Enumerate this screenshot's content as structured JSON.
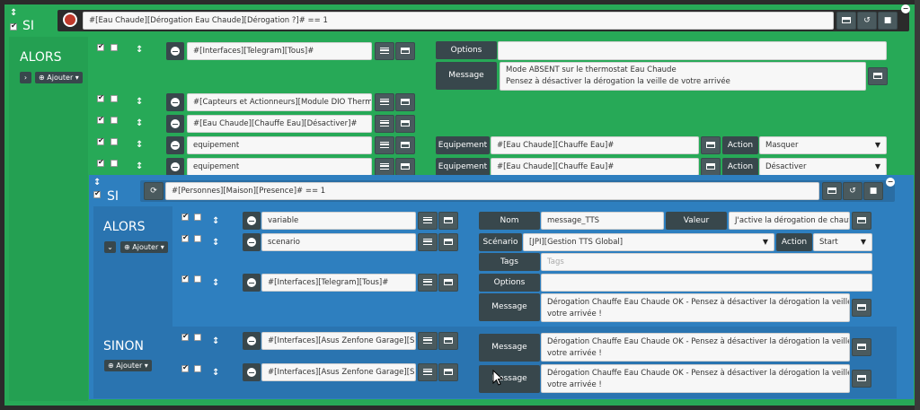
{
  "outer": {
    "si_label": "SI",
    "condition": "#[Eau Chaude][Dérogation Eau Chaude][Dérogation ?]# == 1",
    "alors_label": "ALORS",
    "add_label": "Ajouter",
    "rows": [
      {
        "cmd": "#[Interfaces][Telegram][Tous]#"
      },
      {
        "cmd": "#[Capteurs et Actionneurs][Module DIO Therm"
      },
      {
        "cmd": "#[Eau Chaude][Chauffe Eau][Désactiver]#"
      },
      {
        "cmd": "equipement"
      },
      {
        "cmd": "equipement"
      }
    ],
    "options_label": "Options",
    "message_label": "Message",
    "message_line1": "Mode ABSENT sur le thermostat Eau Chaude",
    "message_line2": "Pensez à désactiver la dérogation la veille de votre arrivée",
    "equipement_label": "Equipement",
    "equipement_value": "#[Eau Chaude][Chauffe Eau]#",
    "action_label": "Action",
    "action1": "Masquer",
    "action2": "Désactiver"
  },
  "inner": {
    "si_label": "SI",
    "condition": "#[Personnes][Maison][Presence]# == 1",
    "alors_label": "ALORS",
    "sinon_label": "SINON",
    "add_label": "Ajouter",
    "rows": [
      {
        "cmd": "variable"
      },
      {
        "cmd": "scenario"
      },
      {
        "cmd": "#[Interfaces][Telegram][Tous]#"
      },
      {
        "cmd": "#[Interfaces][Asus Zenfone Garage][SI"
      },
      {
        "cmd": "#[Interfaces][Asus Zenfone Garage][SI"
      }
    ],
    "nom_label": "Nom",
    "nom_value": "message_TTS",
    "valeur_label": "Valeur",
    "valeur_value": "J'active la dérogation de chauffe",
    "scenario_label": "Scénario",
    "scenario_value": "[JPI][Gestion TTS Global]",
    "action_label": "Action",
    "action_value": "Start",
    "tags_label": "Tags",
    "tags_placeholder": "Tags",
    "options_label": "Options",
    "message_label": "Message",
    "msg_a1": "Dérogation Chauffe Eau Chaude OK - Pensez à désactiver la dérogation la veille de",
    "msg_a2": "votre arrivée !"
  },
  "colors": {
    "green": "#27a957",
    "blue": "#2e7fbf",
    "dark": "#38474c"
  }
}
